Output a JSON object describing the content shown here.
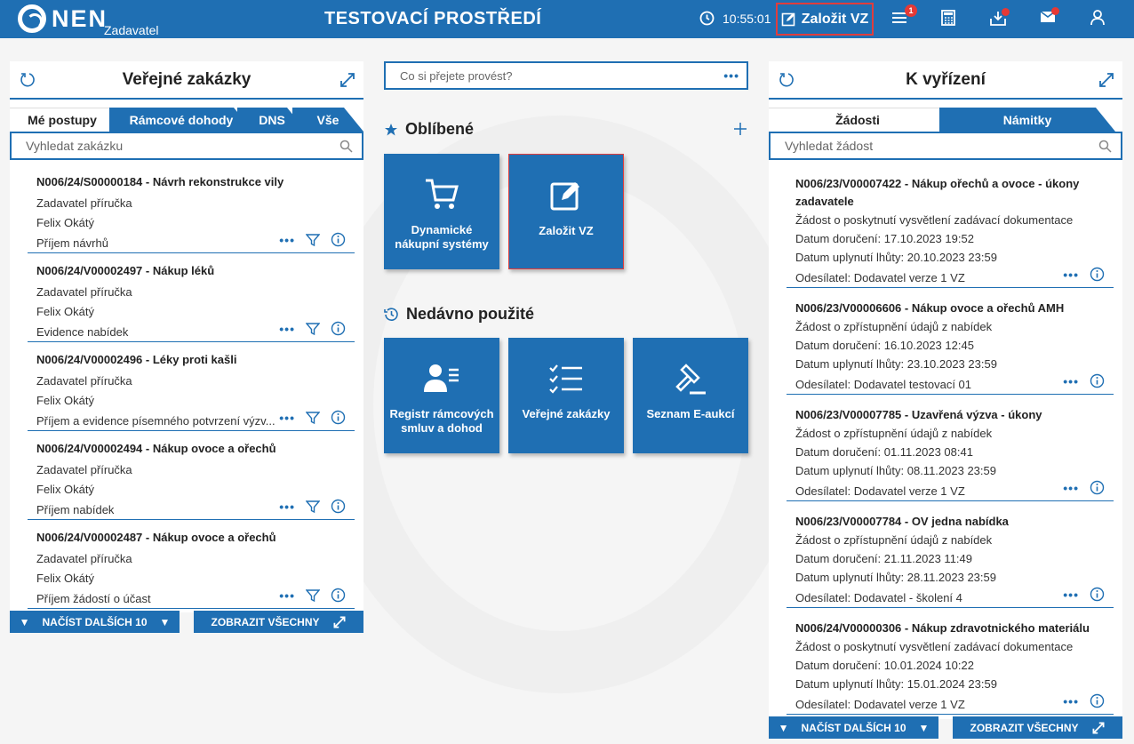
{
  "topbar": {
    "brand": "NEN",
    "brand_sub": "Zadavatel",
    "env_title": "TESTOVACÍ PROSTŘEDÍ",
    "time": "10:55:01",
    "create_label": "Založit VZ",
    "menu_badge": "1"
  },
  "left": {
    "title": "Veřejné zakázky",
    "tabs": [
      "Mé postupy",
      "Rámcové dohody",
      "DNS",
      "Vše"
    ],
    "search_placeholder": "Vyhledat zakázku",
    "items": [
      {
        "title": "N006/24/S00000184 - Návrh rekonstrukce vily",
        "l1": "Zadavatel příručka",
        "l2": "Felix Okátý",
        "l3": "Příjem návrhů"
      },
      {
        "title": "N006/24/V00002497 - Nákup léků",
        "l1": "Zadavatel příručka",
        "l2": "Felix Okátý",
        "l3": "Evidence nabídek"
      },
      {
        "title": "N006/24/V00002496 - Léky proti kašli",
        "l1": "Zadavatel příručka",
        "l2": "Felix Okátý",
        "l3": "Příjem a evidence písemného potvrzení výzv..."
      },
      {
        "title": "N006/24/V00002494 - Nákup ovoce a ořechů",
        "l1": "Zadavatel příručka",
        "l2": "Felix Okátý",
        "l3": "Příjem nabídek"
      },
      {
        "title": "N006/24/V00002487 - Nákup ovoce a ořechů",
        "l1": "Zadavatel příručka",
        "l2": "Felix Okátý",
        "l3": "Příjem žádostí o účast"
      }
    ],
    "load_more": "NAČÍST DALŠÍCH 10",
    "show_all": "ZOBRAZIT VŠECHNY"
  },
  "center": {
    "search_placeholder": "Co si přejete provést?",
    "favorites_title": "Oblíbené",
    "favorites": [
      {
        "label": "Dynamické nákupní systémy",
        "icon": "cart-icon"
      },
      {
        "label": "Založit VZ",
        "icon": "edit-icon"
      }
    ],
    "recent_title": "Nedávno použité",
    "recent": [
      {
        "label": "Registr rámcových smluv a dohod",
        "icon": "user-list-icon"
      },
      {
        "label": "Veřejné zakázky",
        "icon": "checklist-icon"
      },
      {
        "label": "Seznam E-aukcí",
        "icon": "gavel-icon"
      }
    ]
  },
  "right": {
    "title": "K vyřízení",
    "tabs": [
      "Žádosti",
      "Námitky"
    ],
    "search_placeholder": "Vyhledat žádost",
    "items": [
      {
        "title": "N006/23/V00007422 - Nákup ořechů a ovoce - úkony zadavatele",
        "type": "Žádost o poskytnutí vysvětlení zadávací dokumentace",
        "delivered": "Datum doručení: 17.10.2023 19:52",
        "deadline": "Datum uplynutí lhůty: 20.10.2023 23:59",
        "sender": "Odesílatel: Dodavatel verze 1 VZ"
      },
      {
        "title": "N006/23/V00006606 - Nákup ovoce a ořechů AMH",
        "type": "Žádost o zpřístupnění údajů z nabídek",
        "delivered": "Datum doručení: 16.10.2023 12:45",
        "deadline": "Datum uplynutí lhůty: 23.10.2023 23:59",
        "sender": "Odesílatel: Dodavatel testovací 01"
      },
      {
        "title": "N006/23/V00007785 - Uzavřená výzva - úkony",
        "type": "Žádost o zpřístupnění údajů z nabídek",
        "delivered": "Datum doručení: 01.11.2023 08:41",
        "deadline": "Datum uplynutí lhůty: 08.11.2023 23:59",
        "sender": "Odesílatel: Dodavatel verze 1 VZ"
      },
      {
        "title": "N006/23/V00007784 - OV jedna nabídka",
        "type": "Žádost o zpřístupnění údajů z nabídek",
        "delivered": "Datum doručení: 21.11.2023 11:49",
        "deadline": "Datum uplynutí lhůty: 28.11.2023 23:59",
        "sender": "Odesílatel: Dodavatel - školení 4"
      },
      {
        "title": "N006/24/V00000306 - Nákup zdravotnického materiálu",
        "type": "Žádost o poskytnutí vysvětlení zadávací dokumentace",
        "delivered": "Datum doručení: 10.01.2024 10:22",
        "deadline": "Datum uplynutí lhůty: 15.01.2024 23:59",
        "sender": "Odesílatel: Dodavatel verze 1 VZ"
      }
    ],
    "load_more": "NAČÍST DALŠÍCH 10",
    "show_all": "ZOBRAZIT VŠECHNY"
  },
  "colors": {
    "primary": "#1f6fb3",
    "alert": "#e53935",
    "highlight_border": "#e03d3d"
  }
}
